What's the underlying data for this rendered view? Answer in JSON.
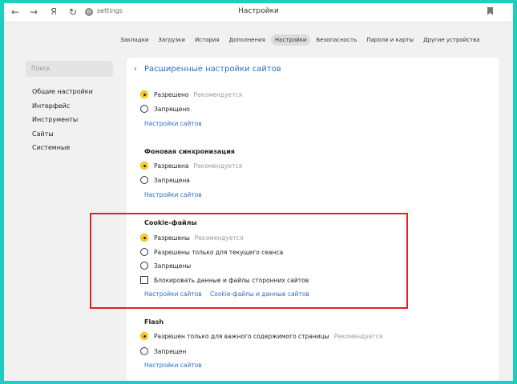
{
  "browser": {
    "address_text": "settings",
    "address_icon_glyph": "⚙",
    "yandex_glyph": "Я",
    "window_title": "Настройки"
  },
  "tabs": [
    {
      "label": "Закладки",
      "active": false
    },
    {
      "label": "Загрузки",
      "active": false
    },
    {
      "label": "История",
      "active": false
    },
    {
      "label": "Дополнения",
      "active": false
    },
    {
      "label": "Настройки",
      "active": true
    },
    {
      "label": "Безопасность",
      "active": false
    },
    {
      "label": "Пароли и карты",
      "active": false
    },
    {
      "label": "Другие устройства",
      "active": false
    }
  ],
  "sidebar": {
    "search_placeholder": "Поиск",
    "items": [
      "Общие настройки",
      "Интерфейс",
      "Инструменты",
      "Сайты",
      "Системные"
    ]
  },
  "panel": {
    "title": "Расширенные настройки сайтов",
    "back_glyph": "‹"
  },
  "sections": {
    "s1": {
      "options": [
        {
          "label": "Разрешено",
          "hint": "Рекомендуется",
          "selected": true
        },
        {
          "label": "Запрещено",
          "hint": "",
          "selected": false
        }
      ],
      "link": "Настройки сайтов"
    },
    "s2": {
      "title": "Фоновая синхронизация",
      "options": [
        {
          "label": "Разрешена",
          "hint": "Рекомендуется",
          "selected": true
        },
        {
          "label": "Запрещена",
          "hint": "",
          "selected": false
        }
      ],
      "link": "Настройки сайтов"
    },
    "s3": {
      "title": "Cookie-файлы",
      "options": [
        {
          "label": "Разрешены",
          "hint": "Рекомендуется",
          "selected": true
        },
        {
          "label": "Разрешены только для текущего сеанса",
          "hint": "",
          "selected": false
        },
        {
          "label": "Запрещены",
          "hint": "",
          "selected": false
        }
      ],
      "checkbox": {
        "label": "Блокировать данные и файлы сторонних сайтов",
        "checked": false
      },
      "link1": "Настройки сайтов",
      "link2": "Cookie-файлы и данные сайтов"
    },
    "s4": {
      "title": "Flash",
      "options": [
        {
          "label": "Разрешен только для важного содержимого страницы",
          "hint": "Рекомендуется",
          "selected": true
        },
        {
          "label": "Запрещен",
          "hint": "",
          "selected": false
        }
      ],
      "link": "Настройки сайтов"
    }
  },
  "colors": {
    "background": "#1ecfc0",
    "accent_yellow": "#ffd21f",
    "link_blue": "#2b6fc2",
    "highlight_red": "#e41e24"
  }
}
